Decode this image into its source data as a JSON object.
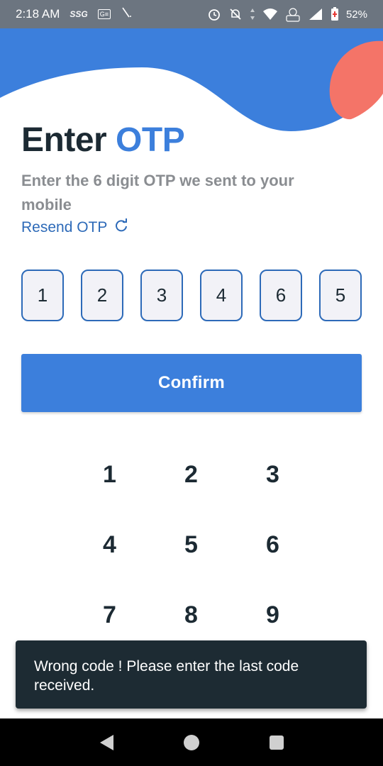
{
  "status_bar": {
    "time": "2:18 AM",
    "carrier_tag": "SSG",
    "app_tag": "G≡",
    "battery_percent": "52%",
    "icons": [
      "alarm-icon",
      "mute-icon",
      "wifi-icon",
      "volte-icon",
      "signal-icon",
      "battery-icon"
    ]
  },
  "title": {
    "prefix": "Enter",
    "accent": "OTP"
  },
  "subtitle": "Enter the 6 digit OTP we sent to your mobile",
  "resend": {
    "label": "Resend OTP",
    "icon": "refresh-icon"
  },
  "otp_digits": [
    "1",
    "2",
    "3",
    "4",
    "6",
    "5"
  ],
  "confirm_label": "Confirm",
  "keypad": [
    "1",
    "2",
    "3",
    "4",
    "5",
    "6",
    "7",
    "8",
    "9"
  ],
  "snackbar": {
    "message": "Wrong code ! Please enter the last code received."
  },
  "nav": {
    "back": "back-icon",
    "home": "home-icon",
    "recents": "recents-icon"
  },
  "colors": {
    "accent": "#3c7fdc",
    "dark_text": "#1c2a33",
    "coral": "#f47468",
    "snackbar_bg": "#1d2b33"
  }
}
